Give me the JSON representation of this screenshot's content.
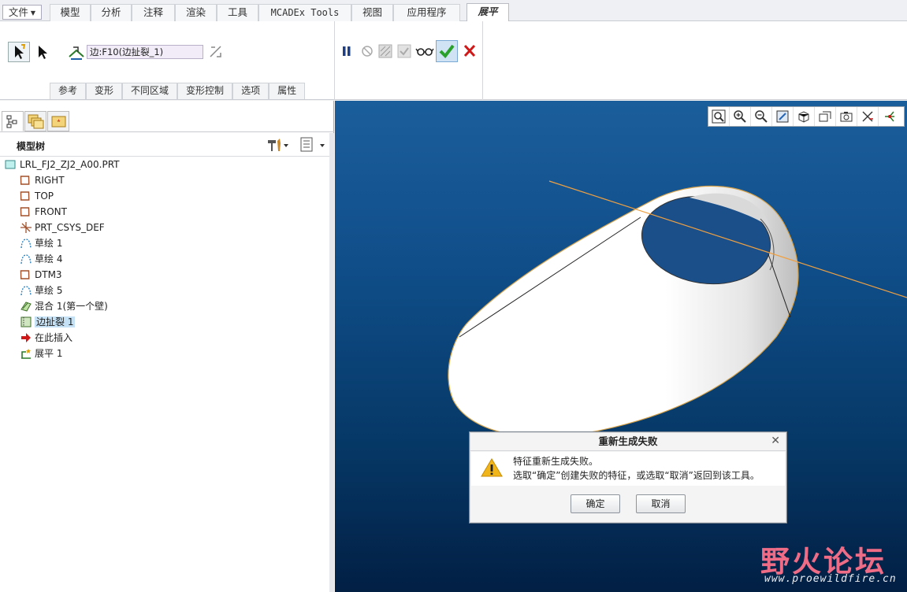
{
  "menubar": {
    "file": "文件",
    "tabs": [
      "模型",
      "分析",
      "注释",
      "渲染",
      "工具",
      "MCADEx Tools",
      "视图",
      "应用程序"
    ],
    "active_tab": "展平"
  },
  "dashboard": {
    "collector_value": "边:F10(边扯裂_1)",
    "subtabs": [
      "参考",
      "变形",
      "不同区域",
      "变形控制",
      "选项",
      "属性"
    ]
  },
  "model_tree": {
    "title": "模型树",
    "root": "LRL_FJ2_ZJ2_A00.PRT",
    "items": [
      {
        "label": "RIGHT",
        "icon": "datum-plane-icon"
      },
      {
        "label": "TOP",
        "icon": "datum-plane-icon"
      },
      {
        "label": "FRONT",
        "icon": "datum-plane-icon"
      },
      {
        "label": "PRT_CSYS_DEF",
        "icon": "csys-icon"
      },
      {
        "label": "草绘 1",
        "icon": "sketch-icon"
      },
      {
        "label": "草绘 4",
        "icon": "sketch-icon"
      },
      {
        "label": "DTM3",
        "icon": "datum-plane-icon"
      },
      {
        "label": "草绘 5",
        "icon": "sketch-icon"
      },
      {
        "label": "混合 1(第一个壁)",
        "icon": "blend-icon"
      },
      {
        "label": "边扯裂 1",
        "icon": "edge-rip-icon"
      },
      {
        "label": "在此插入",
        "icon": "insert-here-arrow-icon"
      },
      {
        "label": "展平 1",
        "icon": "flatten-icon"
      }
    ]
  },
  "dialog": {
    "title": "重新生成失败",
    "line1": "特征重新生成失败。",
    "line2": "选取“确定”创建失败的特征，或选取“取消”返回到该工具。",
    "ok": "确定",
    "cancel": "取消"
  },
  "watermark": {
    "text": "野火论坛",
    "url": "www.proewildfire.cn"
  },
  "colors": {
    "graphics_top": "#1b5e9c",
    "graphics_bottom": "#021f44",
    "highlight": "#c5e1f5",
    "confirm_green": "#2aa12a",
    "cancel_red": "#d01818",
    "watermark": "#ef6c86"
  }
}
